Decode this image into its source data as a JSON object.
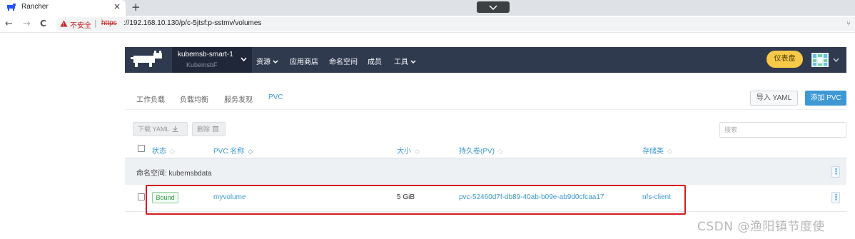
{
  "browser": {
    "tab_title": "Rancher",
    "tab_close": "×",
    "new_tab": "+",
    "back": "←",
    "forward": "→",
    "reload": "C",
    "insecure_label": "不安全",
    "url_separator": "|",
    "url_protocol": "https",
    "url_rest": "://192.168.10.130/p/c-5jtsf:p-sstmv/volumes",
    "omni_edge": "⑂"
  },
  "header": {
    "cluster_name": "kubemsb-smart-1",
    "cluster_sub": "KubemsbF",
    "nav": [
      {
        "label": "资源",
        "has_caret": true
      },
      {
        "label": "应用商店",
        "has_caret": false
      },
      {
        "label": "命名空间",
        "has_caret": false
      },
      {
        "label": "成员",
        "has_caret": false
      },
      {
        "label": "工具",
        "has_caret": true
      }
    ],
    "dashboard_button": "仪表盘",
    "header_bg": "#2f3a4f",
    "accent": "#3d98d3"
  },
  "tabs": [
    {
      "label": "工作负载",
      "active": false
    },
    {
      "label": "负载均衡",
      "active": false
    },
    {
      "label": "服务发现",
      "active": false
    },
    {
      "label": "PVC",
      "active": true
    }
  ],
  "actions": {
    "import_yaml": "导入 YAML",
    "add_pvc": "添加 PVC"
  },
  "bulk": {
    "download_yaml": "下载 YAML",
    "delete": "删除"
  },
  "search": {
    "placeholder": "搜索"
  },
  "table": {
    "columns": [
      "状态",
      "PVC 名称",
      "大小",
      "持久卷(PV)",
      "存储类"
    ],
    "sort_glyph": "◇",
    "group_label": "命名空间: kubemsbdata",
    "rows": [
      {
        "status": "Bound",
        "name": "myvolume",
        "size": "5 GiB",
        "pv": "pvc-52460d7f-db89-40ab-b09e-ab9d0cfcaa17",
        "storage_class": "nfs-client"
      }
    ],
    "kebab": "⋮"
  },
  "watermark": "CSDN @渔阳镇节度使"
}
